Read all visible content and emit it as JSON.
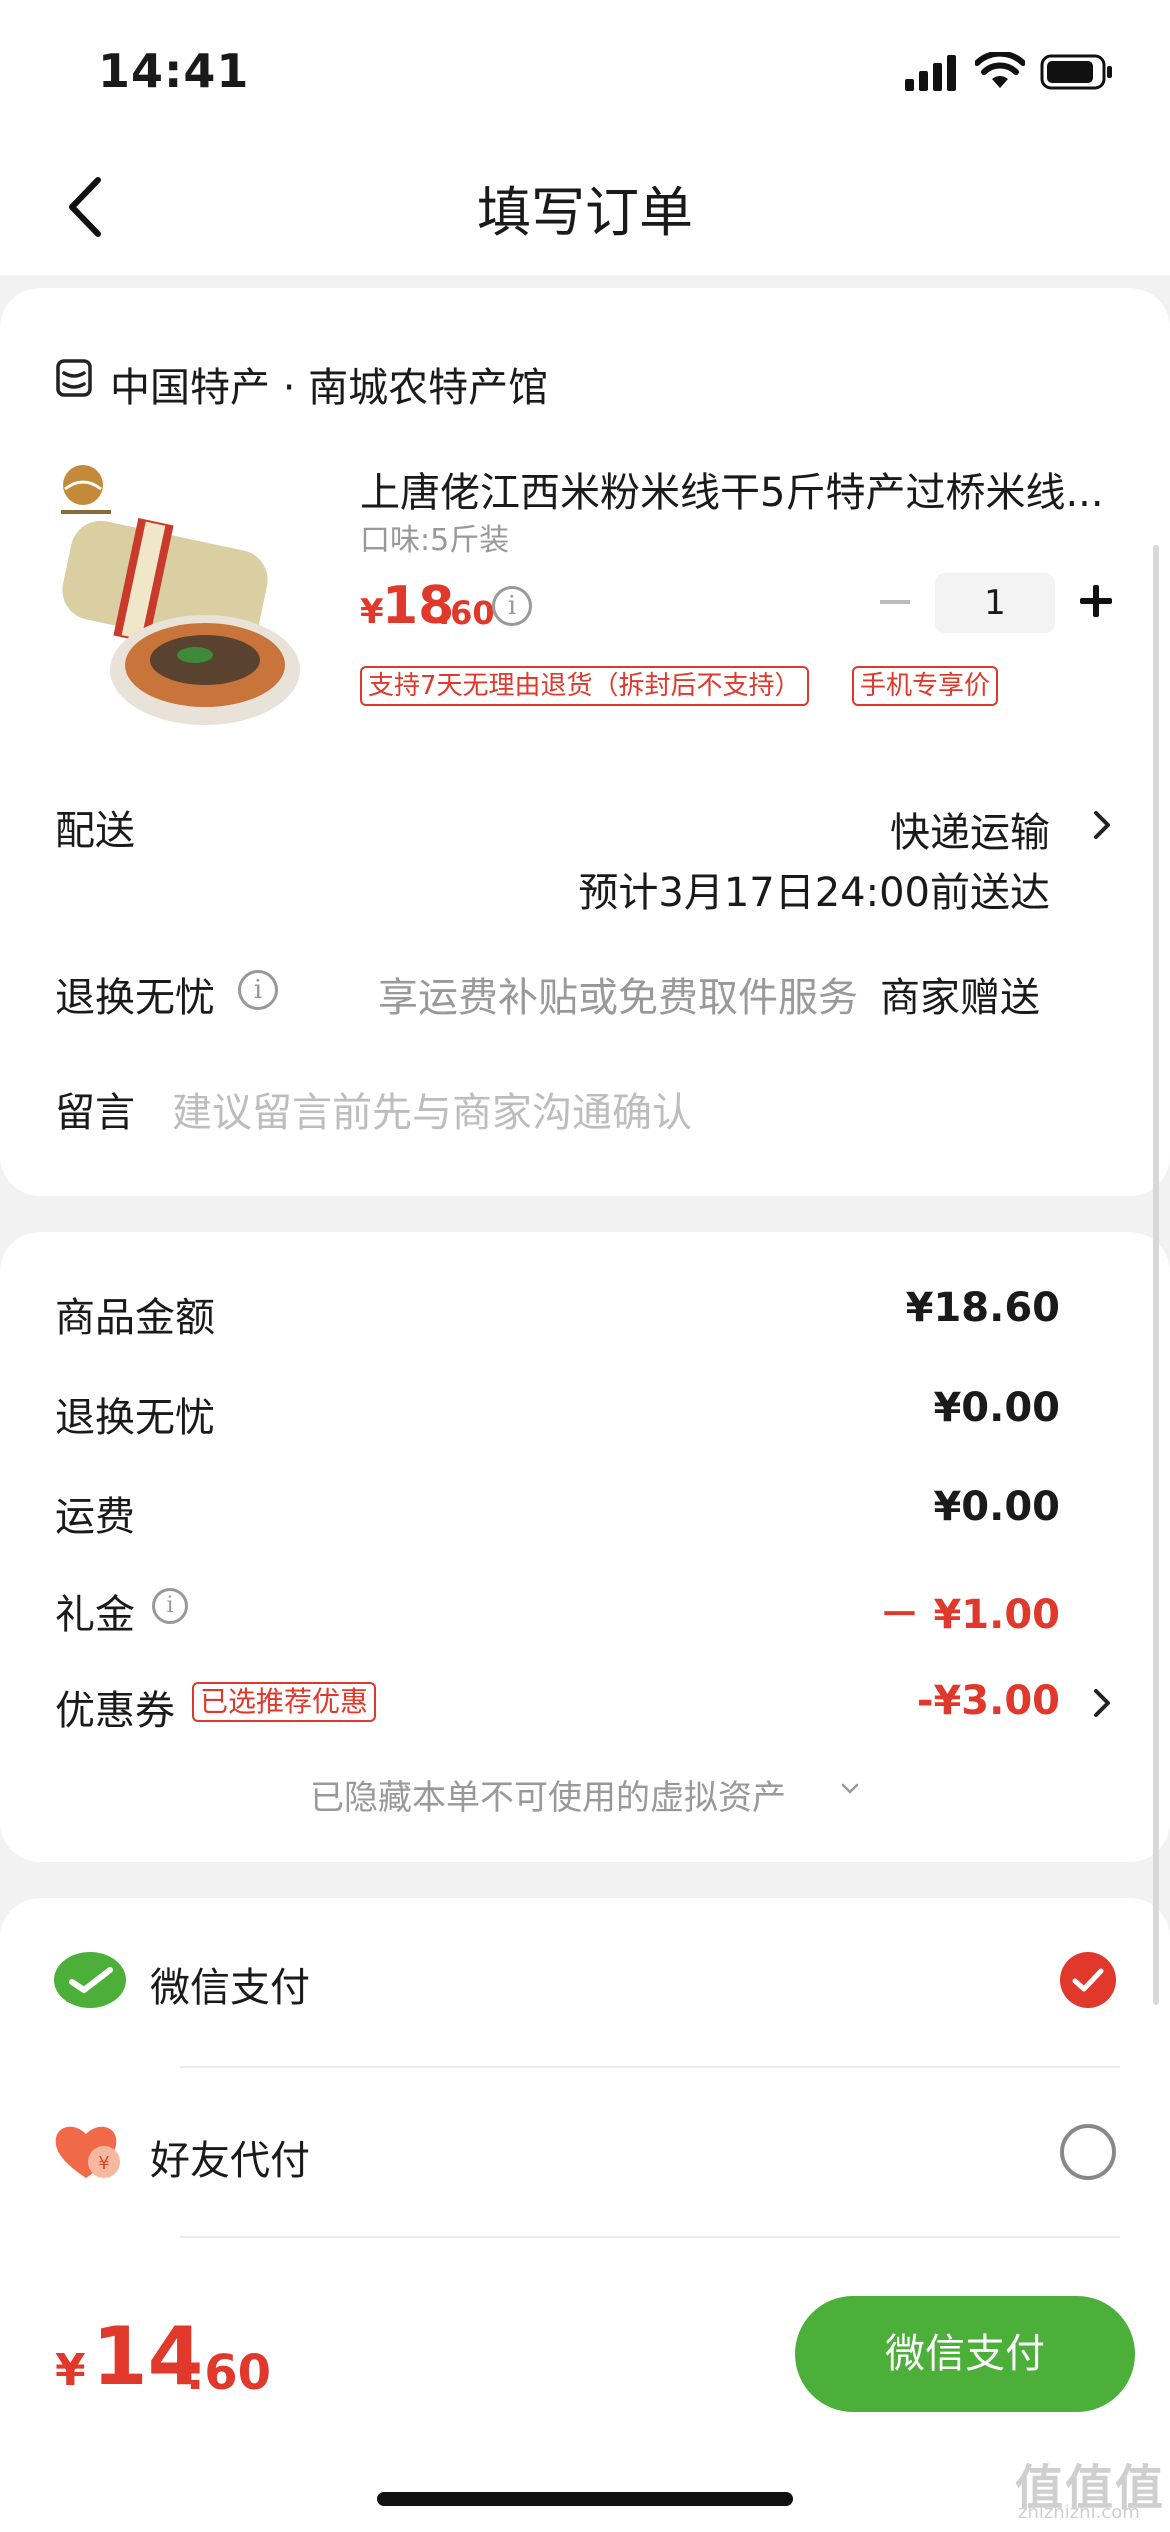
{
  "status_bar": {
    "time": "14:41"
  },
  "nav": {
    "title": "填写订单"
  },
  "shop": {
    "name": "中国特产 · 南城农特产馆"
  },
  "product": {
    "title": "上唐佬江西米粉米线干5斤特产过桥米线...",
    "spec": "口味:5斤装",
    "price_currency": "¥",
    "price_int": "18",
    "price_dec": ".60",
    "quantity": "1",
    "tags": [
      "支持7天无理由退货（拆封后不支持）",
      "手机专享价"
    ]
  },
  "delivery": {
    "label": "配送",
    "method": "快递运输",
    "eta": "预计3月17日24:00前送达"
  },
  "return_service": {
    "label": "退换无忧",
    "desc": "享运费补贴或免费取件服务",
    "value": "商家赠送"
  },
  "message": {
    "label": "留言",
    "placeholder": "建议留言前先与商家沟通确认"
  },
  "summary": {
    "rows": [
      {
        "label": "商品金额",
        "value": "¥18.60"
      },
      {
        "label": "退换无忧",
        "value": "¥0.00"
      },
      {
        "label": "运费",
        "value": "¥0.00"
      },
      {
        "label": "礼金",
        "value": "－ ¥1.00"
      },
      {
        "label": "优惠券",
        "value": "-¥3.00",
        "tag": "已选推荐优惠"
      }
    ],
    "hidden_note": "已隐藏本单不可使用的虚拟资产"
  },
  "payment": {
    "options": [
      {
        "label": "微信支付",
        "selected": true
      },
      {
        "label": "好友代付",
        "selected": false
      }
    ]
  },
  "footer": {
    "total_currency": "¥",
    "total_int": "14",
    "total_dec": ".60",
    "pay_button": "微信支付"
  },
  "watermark": {
    "main": "值值值",
    "sub": "zhizhizhi.com"
  },
  "colors": {
    "accent": "#e0382a",
    "wechat_green": "#4caf3a"
  }
}
